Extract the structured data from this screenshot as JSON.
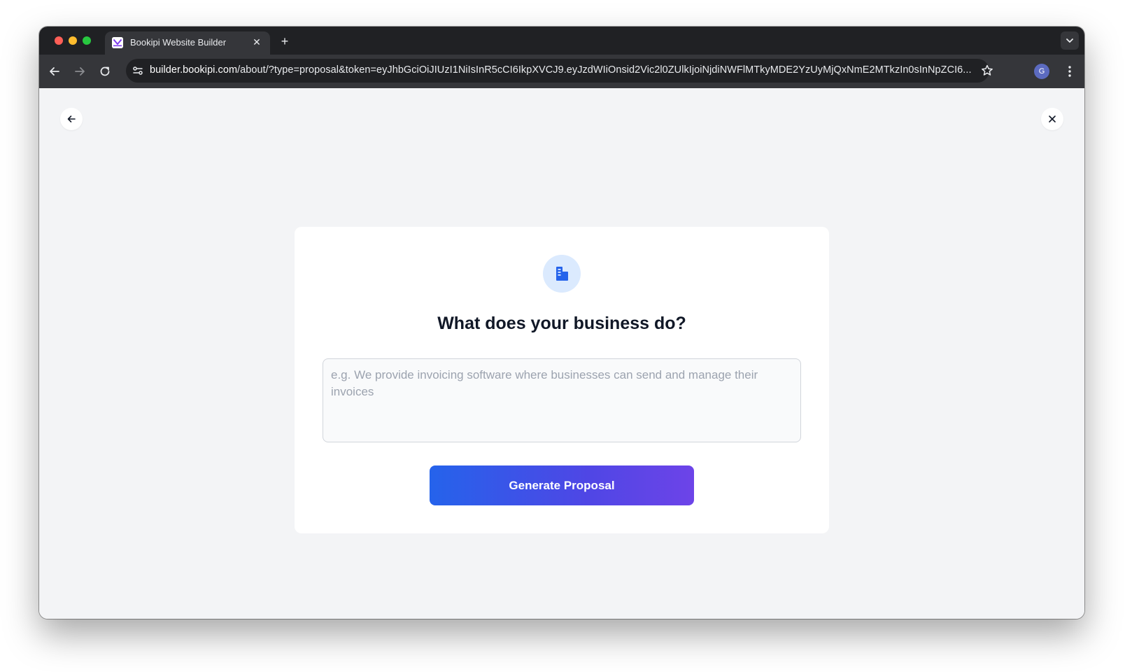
{
  "browser": {
    "tab_title": "Bookipi Website Builder",
    "url_host": "builder.bookipi.com",
    "url_rest": "/about/?type=proposal&token=eyJhbGciOiJIUzI1NiIsInR5cCI6IkpXVCJ9.eyJzdWIiOnsid2Vic2l0ZUlkIjoiNjdiNWFlMTkyMDE2YzUyMjQxNmE2MTkzIn0sInNpZCI6...",
    "profile_initial": "G"
  },
  "form": {
    "title": "What does your business do?",
    "placeholder": "e.g. We provide invoicing software where businesses can send and manage their invoices",
    "value": "",
    "submit_label": "Generate Proposal"
  },
  "colors": {
    "accent_start": "#2563eb",
    "accent_end": "#6d44e8",
    "icon_bg": "#dbeafe",
    "icon_fg": "#2563eb"
  }
}
